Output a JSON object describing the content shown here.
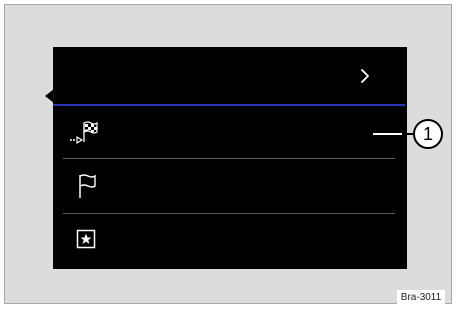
{
  "screen": {
    "header_chevron_icon": "chevron-right-icon",
    "items": [
      {
        "icon": "destination-flag-checkered-icon"
      },
      {
        "icon": "flag-outline-icon"
      },
      {
        "icon": "star-box-icon"
      }
    ]
  },
  "callout": {
    "number": "1"
  },
  "figure": {
    "reference_code": "Bra-3011"
  },
  "colors": {
    "screen_bg": "#000000",
    "header_divider": "#2e35b4",
    "frame_bg": "#dcdcdc",
    "icon_color": "#ffffff"
  }
}
